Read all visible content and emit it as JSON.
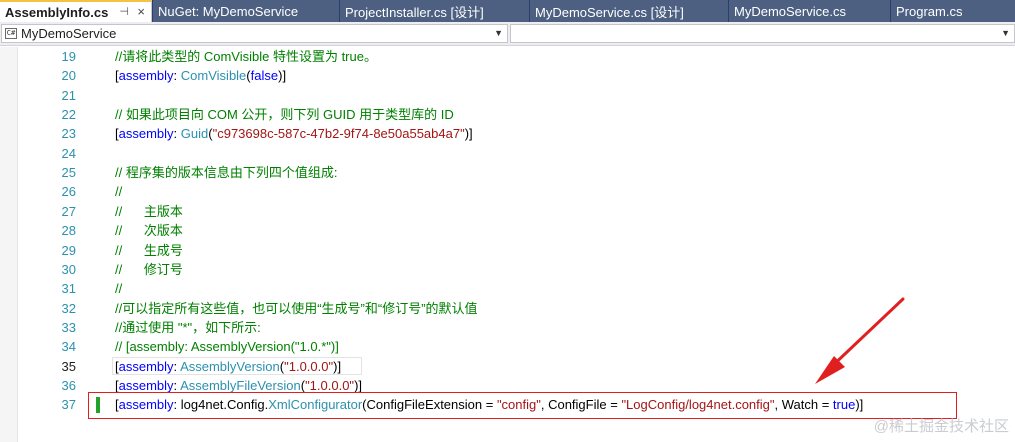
{
  "tabs": [
    {
      "label": "AssemblyInfo.cs",
      "active": true,
      "pin": "⊣",
      "close": "×"
    },
    {
      "label": "NuGet: MyDemoService"
    },
    {
      "label": "ProjectInstaller.cs [设计]"
    },
    {
      "label": "MyDemoService.cs [设计]"
    },
    {
      "label": "MyDemoService.cs"
    },
    {
      "label": "Program.cs"
    }
  ],
  "navbar": {
    "project_icon": "C#",
    "project": "MyDemoService",
    "member": "",
    "dropdown_glyph": "▼"
  },
  "lines": [
    {
      "n": "19",
      "tokens": [
        {
          "t": "//请将此类型的 ComVisible 特性设置为 true。",
          "c": "cm"
        }
      ]
    },
    {
      "n": "20",
      "tokens": [
        {
          "t": "[",
          "c": ""
        },
        {
          "t": "assembly",
          "c": "kw"
        },
        {
          "t": ": ",
          "c": ""
        },
        {
          "t": "ComVisible",
          "c": "ty"
        },
        {
          "t": "(",
          "c": ""
        },
        {
          "t": "false",
          "c": "kw"
        },
        {
          "t": ")]",
          "c": ""
        }
      ]
    },
    {
      "n": "21",
      "tokens": []
    },
    {
      "n": "22",
      "tokens": [
        {
          "t": "// 如果此项目向 COM 公开，则下列 GUID 用于类型库的 ID",
          "c": "cm"
        }
      ]
    },
    {
      "n": "23",
      "tokens": [
        {
          "t": "[",
          "c": ""
        },
        {
          "t": "assembly",
          "c": "kw"
        },
        {
          "t": ": ",
          "c": ""
        },
        {
          "t": "Guid",
          "c": "ty"
        },
        {
          "t": "(",
          "c": ""
        },
        {
          "t": "\"c973698c-587c-47b2-9f74-8e50a55ab4a7\"",
          "c": "st"
        },
        {
          "t": ")]",
          "c": ""
        }
      ]
    },
    {
      "n": "24",
      "tokens": []
    },
    {
      "n": "25",
      "tokens": [
        {
          "t": "// 程序集的版本信息由下列四个值组成:",
          "c": "cm"
        }
      ]
    },
    {
      "n": "26",
      "tokens": [
        {
          "t": "//",
          "c": "cm"
        }
      ]
    },
    {
      "n": "27",
      "tokens": [
        {
          "t": "//      主版本",
          "c": "cm"
        }
      ]
    },
    {
      "n": "28",
      "tokens": [
        {
          "t": "//      次版本",
          "c": "cm"
        }
      ]
    },
    {
      "n": "29",
      "tokens": [
        {
          "t": "//      生成号",
          "c": "cm"
        }
      ]
    },
    {
      "n": "30",
      "tokens": [
        {
          "t": "//      修订号",
          "c": "cm"
        }
      ]
    },
    {
      "n": "31",
      "tokens": [
        {
          "t": "//",
          "c": "cm"
        }
      ]
    },
    {
      "n": "32",
      "tokens": [
        {
          "t": "//可以指定所有这些值，也可以使用“生成号”和“修订号”的默认值",
          "c": "cm"
        }
      ]
    },
    {
      "n": "33",
      "tokens": [
        {
          "t": "//通过使用 \"*\"，如下所示:",
          "c": "cm"
        }
      ]
    },
    {
      "n": "34",
      "tokens": [
        {
          "t": "// [assembly: AssemblyVersion(\"1.0.*\")]",
          "c": "cm"
        }
      ]
    },
    {
      "n": "35",
      "current": true,
      "tokens": [
        {
          "t": "[",
          "c": ""
        },
        {
          "t": "assembly",
          "c": "kw"
        },
        {
          "t": ": ",
          "c": ""
        },
        {
          "t": "AssemblyVersion",
          "c": "ty"
        },
        {
          "t": "(",
          "c": ""
        },
        {
          "t": "\"1.0.0.0\"",
          "c": "st"
        },
        {
          "t": ")]",
          "c": ""
        }
      ]
    },
    {
      "n": "36",
      "tokens": [
        {
          "t": "[",
          "c": ""
        },
        {
          "t": "assembly",
          "c": "kw"
        },
        {
          "t": ": ",
          "c": ""
        },
        {
          "t": "AssemblyFileVersion",
          "c": "ty"
        },
        {
          "t": "(",
          "c": ""
        },
        {
          "t": "\"1.0.0.0\"",
          "c": "st"
        },
        {
          "t": ")]",
          "c": ""
        }
      ]
    },
    {
      "n": "37",
      "changed": true,
      "tokens": [
        {
          "t": "[",
          "c": ""
        },
        {
          "t": "assembly",
          "c": "kw"
        },
        {
          "t": ": log4net.Config.",
          "c": ""
        },
        {
          "t": "XmlConfigurator",
          "c": "ty"
        },
        {
          "t": "(ConfigFileExtension = ",
          "c": ""
        },
        {
          "t": "\"config\"",
          "c": "st"
        },
        {
          "t": ", ConfigFile = ",
          "c": ""
        },
        {
          "t": "\"LogConfig/log4net.config\"",
          "c": "st"
        },
        {
          "t": ", Watch = ",
          "c": ""
        },
        {
          "t": "true",
          "c": "kw"
        },
        {
          "t": ")]",
          "c": ""
        }
      ]
    }
  ],
  "annotation": {
    "color": "#e02020"
  },
  "watermark": "@稀土掘金技术社区",
  "colors": {
    "keyword": "#0000ff",
    "type": "#2b91af",
    "string": "#a31515",
    "comment": "#008000",
    "tab_strip": "#2b3f6e",
    "active_tab_accent": "#f5c343"
  }
}
